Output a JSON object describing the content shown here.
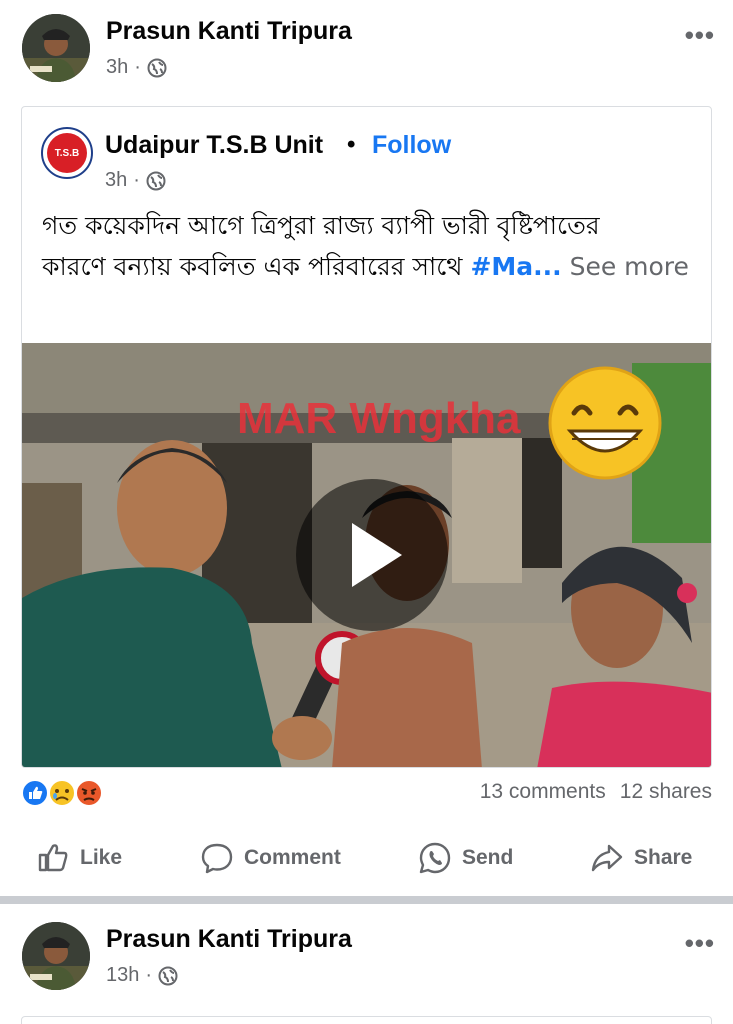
{
  "post": {
    "author": "Prasun Kanti Tripura",
    "time": "3h",
    "more_label": "•••",
    "shared": {
      "page_name": "Udaipur T.S.B Unit",
      "separator": "•",
      "follow_label": "Follow",
      "time": "3h",
      "logo_text": "T.S.B",
      "text_line1": "গত কয়েকদিন আগে ত্রিপুরা রাজ্য ব্যাপী ভারী বৃষ্টিপাতের",
      "text_line2_prefix": "কারণে বন্যায় কবলিত এক পরিবারের সাথে ",
      "hashtag": "#Ma...",
      "see_more": " See more",
      "video": {
        "overlay_text": "MAR Wngkha",
        "emoji": "😁"
      }
    },
    "reactions": [
      "like-reaction-icon",
      "sad-reaction-icon",
      "angry-reaction-icon"
    ],
    "comments_label": "13 comments",
    "shares_label": "12 shares",
    "actions": {
      "like": "Like",
      "comment": "Comment",
      "send": "Send",
      "share": "Share"
    }
  },
  "post2": {
    "author": "Prasun Kanti Tripura",
    "time": "13h",
    "more_label": "•••"
  },
  "colors": {
    "accent": "#1877f2",
    "secondary_text": "#65676b",
    "divider": "#c9ccd1"
  }
}
